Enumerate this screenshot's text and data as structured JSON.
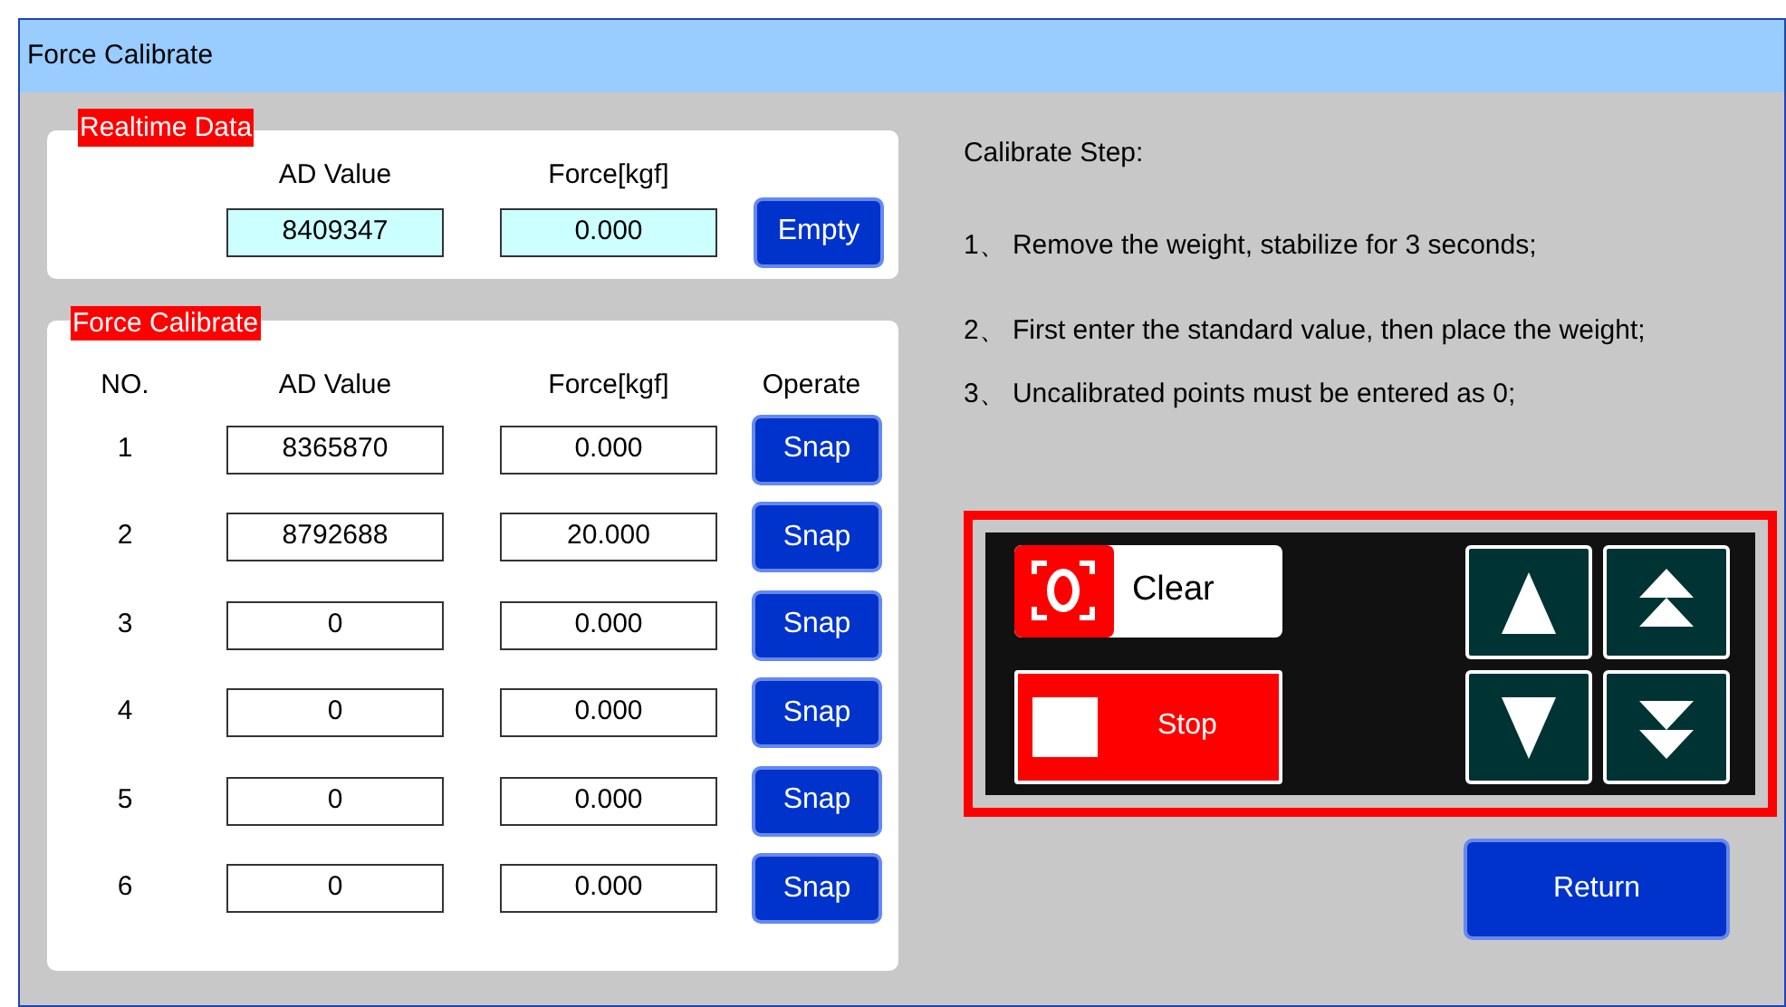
{
  "window": {
    "title": "Force Calibrate"
  },
  "realtime": {
    "label": "Realtime Data",
    "headers": [
      "AD Value",
      "Force[kgf]"
    ],
    "ad_value": "8409347",
    "force": "0.000",
    "button": "Empty"
  },
  "calibrate": {
    "label": "Force Calibrate",
    "headers": [
      "NO.",
      "AD Value",
      "Force[kgf]",
      "Operate"
    ],
    "rows": [
      {
        "no": "1",
        "ad": "8365870",
        "force": "0.000",
        "button": "Snap"
      },
      {
        "no": "2",
        "ad": "8792688",
        "force": "20.000",
        "button": "Snap"
      },
      {
        "no": "3",
        "ad": "0",
        "force": "0.000",
        "button": "Snap"
      },
      {
        "no": "4",
        "ad": "0",
        "force": "0.000",
        "button": "Snap"
      },
      {
        "no": "5",
        "ad": "0",
        "force": "0.000",
        "button": "Snap"
      },
      {
        "no": "6",
        "ad": "0",
        "force": "0.000",
        "button": "Snap"
      }
    ]
  },
  "steps": {
    "title": "Calibrate Step:",
    "items": [
      {
        "num": "1、",
        "text": "Remove the weight, stabilize for 3 seconds;"
      },
      {
        "num": "2、",
        "text": "First enter the standard value, then place the weight;"
      },
      {
        "num": "3、",
        "text": "Uncalibrated points must be entered as 0;"
      }
    ]
  },
  "controls": {
    "clear": "Clear",
    "stop": "Stop",
    "arrows": [
      {
        "kind": "up"
      },
      {
        "kind": "fast-up"
      },
      {
        "kind": "down"
      },
      {
        "kind": "fast-down"
      }
    ]
  },
  "return_button": "Return"
}
